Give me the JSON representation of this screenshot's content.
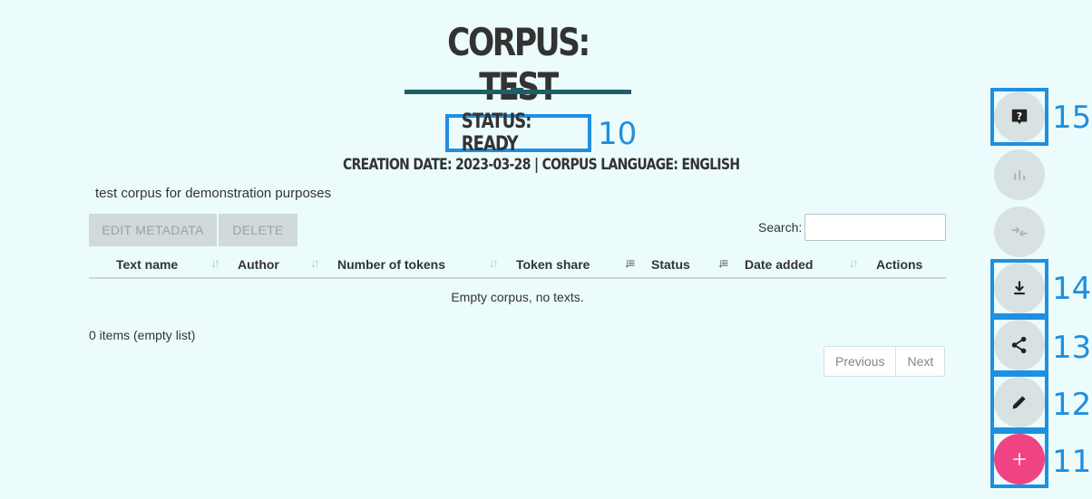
{
  "header": {
    "title": "CORPUS: TEST",
    "status": "STATUS: READY",
    "meta": "CREATION DATE: 2023-03-28 | CORPUS LANGUAGE: ENGLISH",
    "description": "test corpus for demonstration purposes"
  },
  "toolbar": {
    "edit_metadata": "EDIT METADATA",
    "delete": "DELETE",
    "search_label": "Search:",
    "search_value": ""
  },
  "table": {
    "columns": [
      "Text name",
      "Author",
      "Number of tokens",
      "Token share",
      "Status",
      "Date added",
      "Actions"
    ],
    "empty_message": "Empty corpus, no texts.",
    "rows": []
  },
  "footer": {
    "items_info": "0 items (empty list)",
    "previous": "Previous",
    "next": "Next"
  },
  "annotations": {
    "status": "10",
    "add": "11",
    "edit": "12",
    "share": "13",
    "download": "14",
    "help": "15"
  },
  "fab_buttons": [
    {
      "icon": "help-icon",
      "enabled": true
    },
    {
      "icon": "chart-icon",
      "enabled": false
    },
    {
      "icon": "compare-icon",
      "enabled": false
    },
    {
      "icon": "download-icon",
      "enabled": true
    },
    {
      "icon": "share-icon",
      "enabled": true
    },
    {
      "icon": "edit-icon",
      "enabled": true
    },
    {
      "icon": "add-icon",
      "enabled": true
    }
  ],
  "colors": {
    "background": "#ecfcfd",
    "accent": "#1e5e66",
    "annotation": "#1f8fe0",
    "add_button": "#f04384",
    "fab": "#d8e2e3"
  }
}
